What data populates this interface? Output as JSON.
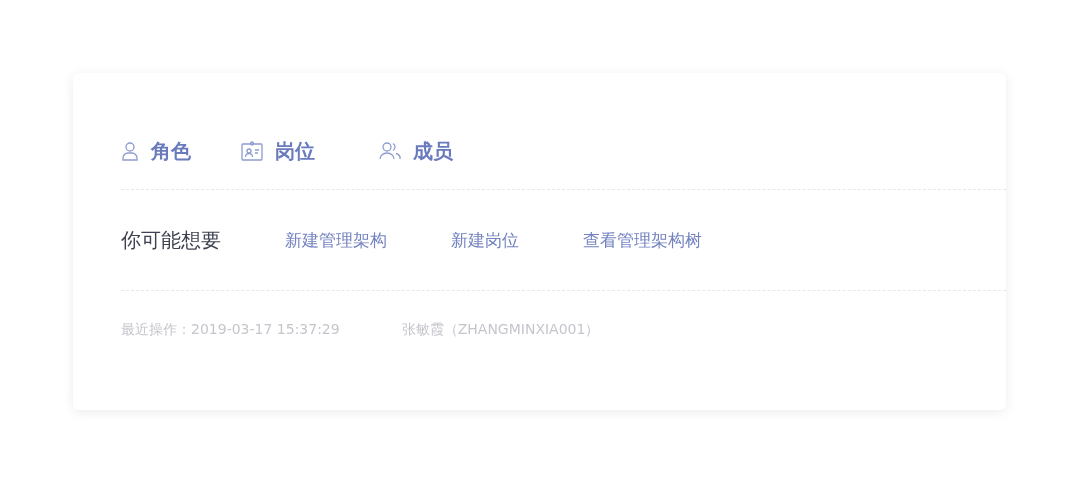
{
  "tabs": [
    {
      "label": "角色",
      "kind": "person"
    },
    {
      "label": "岗位",
      "kind": "badge"
    },
    {
      "label": "成员",
      "kind": "people"
    }
  ],
  "suggestions": {
    "title": "你可能想要",
    "links": [
      "新建管理架构",
      "新建岗位",
      "查看管理架构树"
    ]
  },
  "footer": {
    "last_operation": "最近操作：2019-03-17 15:37:29",
    "operator": "张敏霞（ZHANGMINXIA001）"
  }
}
